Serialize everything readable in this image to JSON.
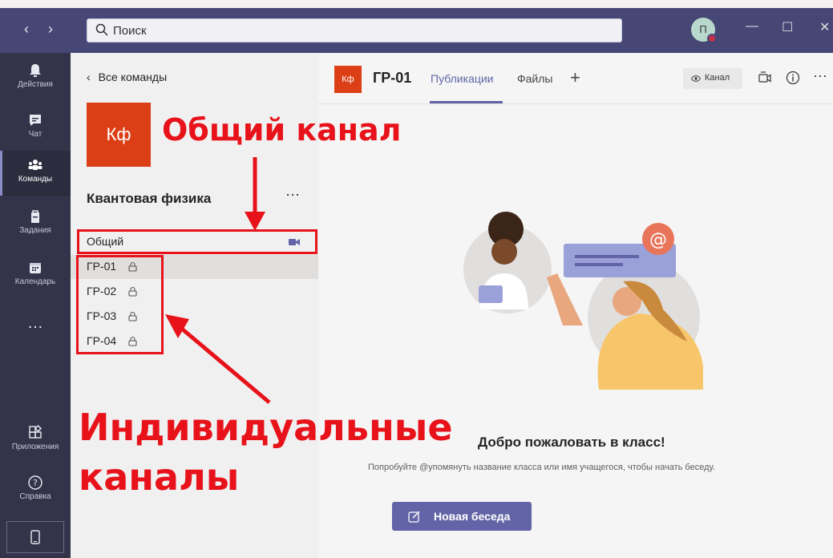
{
  "titlebar": {
    "search_placeholder": "Поиск",
    "avatar_initial": "П"
  },
  "rail": {
    "items": [
      {
        "label": "Действия",
        "icon": "bell-icon"
      },
      {
        "label": "Чат",
        "icon": "chat-icon"
      },
      {
        "label": "Команды",
        "icon": "teams-icon"
      },
      {
        "label": "Задания",
        "icon": "assignments-icon"
      },
      {
        "label": "Календарь",
        "icon": "calendar-icon"
      },
      {
        "label": "…",
        "icon": "more-icon"
      },
      {
        "label": "Приложения",
        "icon": "apps-icon"
      },
      {
        "label": "Справка",
        "icon": "help-icon"
      },
      {
        "label": "",
        "icon": "device-icon"
      }
    ],
    "active": "Команды"
  },
  "team": {
    "back_label": "Все команды",
    "logo": "Кф",
    "name": "Квантовая физика",
    "more": "···",
    "channels": [
      {
        "name": "Общий",
        "private": false
      },
      {
        "name": "ГР-01",
        "private": true
      },
      {
        "name": "ГР-02",
        "private": true
      },
      {
        "name": "ГР-03",
        "private": true
      },
      {
        "name": "ГР-04",
        "private": true
      }
    ],
    "selected_channel": "ГР-01"
  },
  "main": {
    "channel_logo": "Кф",
    "channel_title": "ГР-01",
    "tabs": [
      "Публикации",
      "Файлы"
    ],
    "active_tab": "Публикации",
    "add_tab": "+",
    "channel_button": "Канал",
    "more": "···",
    "welcome_title": "Добро пожаловать в класс!",
    "welcome_hint": "Попробуйте @упомянуть название класса или имя учащегося, чтобы начать беседу.",
    "new_conversation": "Новая беседа"
  },
  "annotations": {
    "general_channel": "Общий канал",
    "individual_channels_line1": "Индивидуальные",
    "individual_channels_line2": "каналы"
  },
  "colors": {
    "titlebar": "#464775",
    "rail": "#33344a",
    "accent": "#6264a7",
    "team_logo": "#dc3e15",
    "annotation_red": "#e8121a"
  }
}
